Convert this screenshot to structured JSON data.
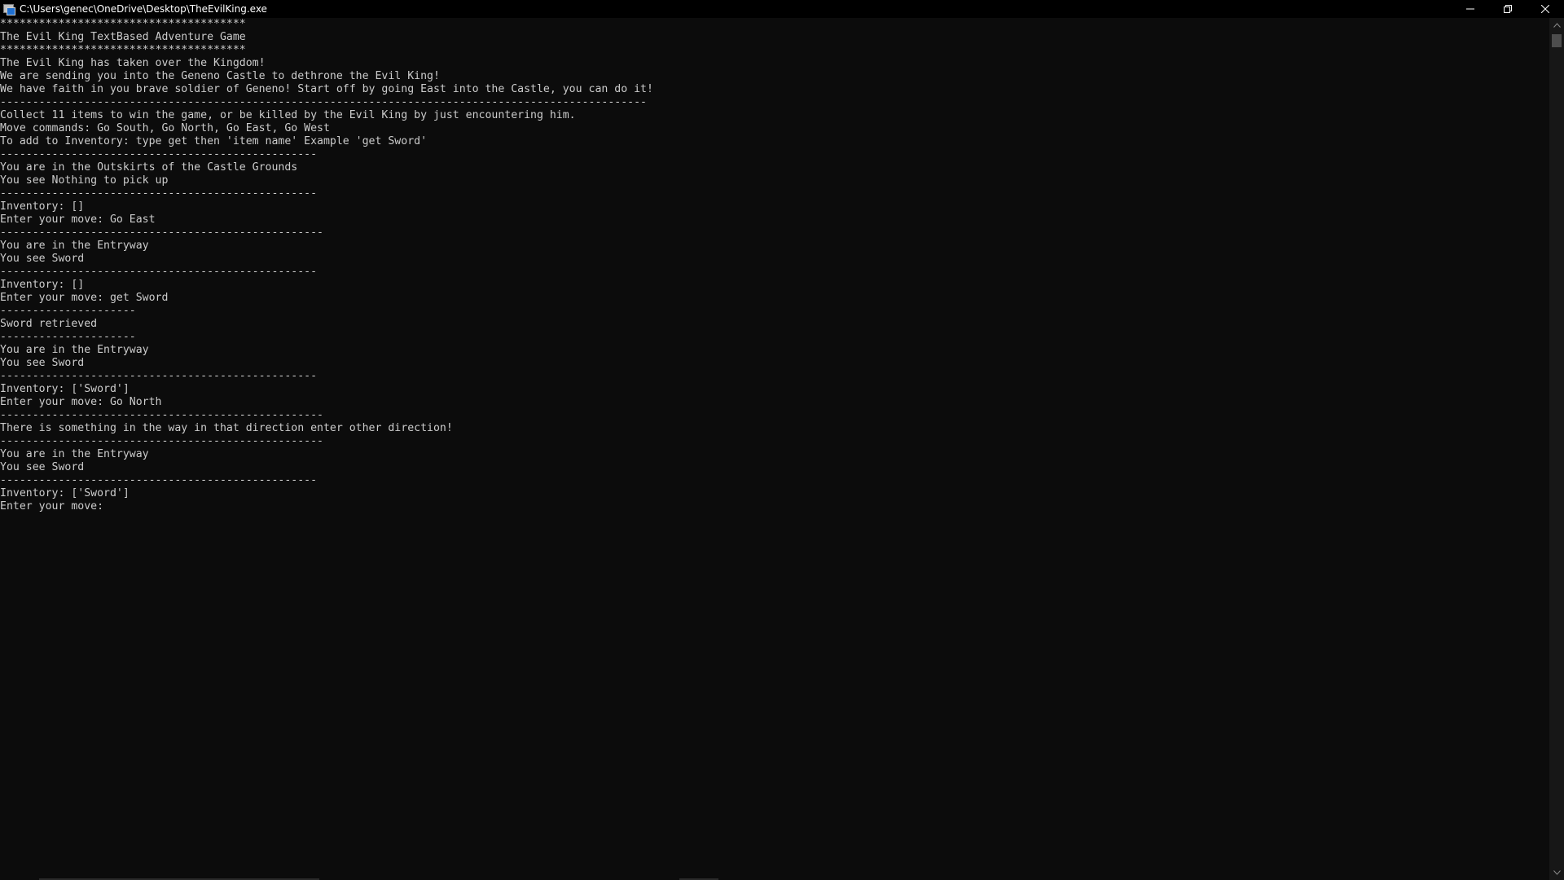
{
  "window": {
    "title": "C:\\Users\\genec\\OneDrive\\Desktop\\TheEvilKing.exe",
    "controls": {
      "minimize_icon": "minimize-icon",
      "restore_icon": "restore-icon",
      "close_icon": "close-icon"
    }
  },
  "console": {
    "lines": [
      "**************************************",
      "The Evil King TextBased Adventure Game",
      "**************************************",
      "The Evil King has taken over the Kingdom!",
      "We are sending you into the Geneno Castle to dethrone the Evil King!",
      "We have faith in you brave soldier of Geneno! Start off by going East into the Castle, you can do it!",
      "----------------------------------------------------------------------------------------------------",
      "Collect 11 items to win the game, or be killed by the Evil King by just encountering him.",
      "Move commands: Go South, Go North, Go East, Go West",
      "To add to Inventory: type get then 'item name' Example 'get Sword'",
      "-------------------------------------------------",
      "You are in the Outskirts of the Castle Grounds",
      "You see Nothing to pick up",
      "-------------------------------------------------",
      "Inventory: []",
      "Enter your move: Go East",
      "--------------------------------------------------",
      "You are in the Entryway",
      "You see Sword",
      "-------------------------------------------------",
      "Inventory: []",
      "Enter your move: get Sword",
      "---------------------",
      "Sword retrieved",
      "---------------------",
      "You are in the Entryway",
      "You see Sword",
      "-------------------------------------------------",
      "Inventory: ['Sword']",
      "Enter your move: Go North",
      "--------------------------------------------------",
      "There is something in the way in that direction enter other direction!",
      "--------------------------------------------------",
      "You are in the Entryway",
      "You see Sword",
      "-------------------------------------------------",
      "Inventory: ['Sword']",
      "Enter your move: "
    ]
  },
  "colors": {
    "background": "#0c0c0c",
    "titlebar": "#000000",
    "text": "#cccccc"
  }
}
